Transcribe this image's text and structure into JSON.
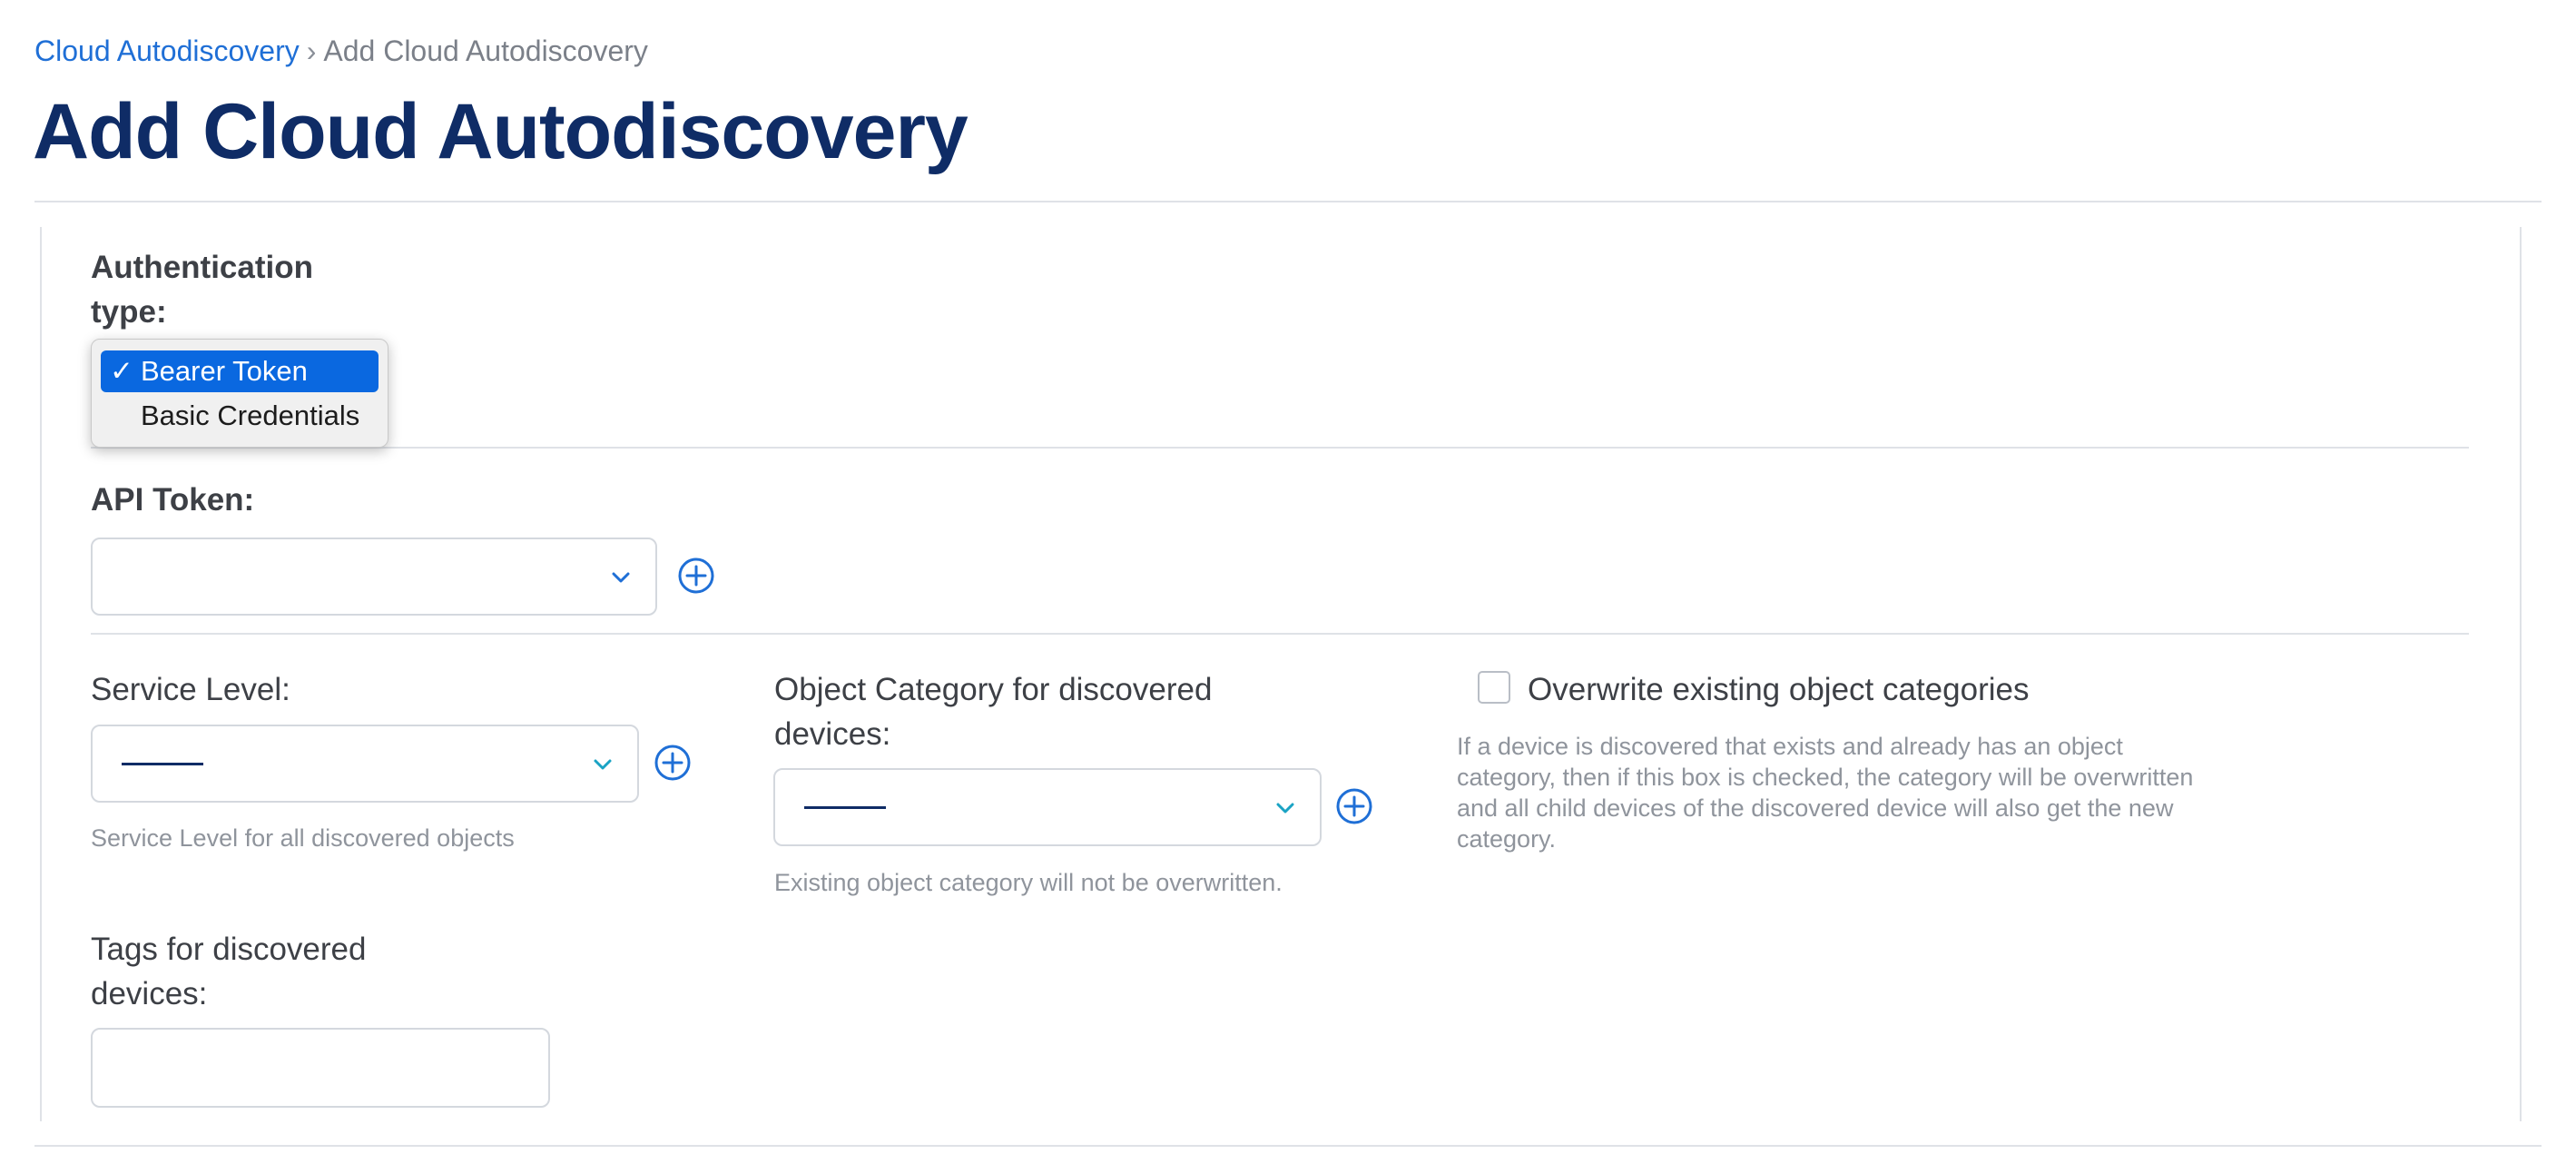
{
  "breadcrumb": {
    "parent": "Cloud Autodiscovery",
    "separator": "›",
    "current": "Add Cloud Autodiscovery"
  },
  "page": {
    "title": "Add Cloud Autodiscovery"
  },
  "auth": {
    "label": "Authentication type:",
    "label_line1": "Authentication",
    "label_line2": "type:",
    "options": [
      "Bearer Token",
      "Basic Credentials"
    ],
    "selected": "Bearer Token",
    "check_mark": "✓"
  },
  "api_token": {
    "label": "API Token:",
    "value": ""
  },
  "service_level": {
    "label": "Service Level:",
    "value": "———",
    "help": "Service Level for all discovered objects"
  },
  "object_category": {
    "label": "Object Category for discovered devices:",
    "label_line1": "Object Category for discovered",
    "label_line2": "devices:",
    "value": "———",
    "help": "Existing object category will not be overwritten."
  },
  "overwrite": {
    "label": "Overwrite existing object categories",
    "checked": false,
    "help_lines": [
      "If a device is discovered that exists and already has an object",
      "category, then if this box is checked, the category will be overwritten",
      "and all child devices of the discovered device will also get the new",
      "category."
    ]
  },
  "tags": {
    "label": "Tags for discovered devices:",
    "label_line1": "Tags for discovered",
    "label_line2": "devices:",
    "value": ""
  },
  "icons": {
    "chevron": "chevron-down-icon",
    "plus": "plus-circle-icon"
  },
  "colors": {
    "link": "#1f6fd6",
    "title": "#0f2c66",
    "accent": "#1f6fd6",
    "chevron_teal": "#1aa3c4",
    "selected_option": "#0a68e0"
  }
}
